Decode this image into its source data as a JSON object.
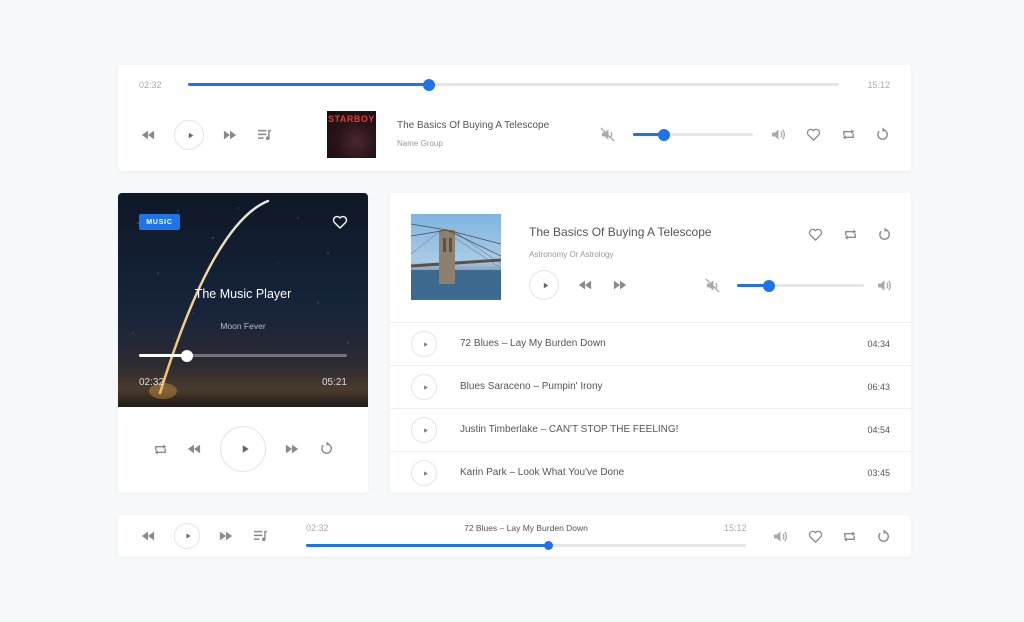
{
  "top_player": {
    "elapsed": "02:32",
    "duration": "15:12",
    "progress": 0.37,
    "track_title": "The Basics Of Buying A Telescope",
    "artist": "Name Group",
    "album_art_text": "STARBOY",
    "volume": 0.26
  },
  "card_player": {
    "badge": "MUSIC",
    "title": "The Music Player",
    "artist": "Moon Fever",
    "elapsed": "02:32",
    "duration": "05:21",
    "progress": 0.23
  },
  "playlist": {
    "title": "The Basics Of Buying A Telescope",
    "subtitle": "Astronomy Or Astrology",
    "volume": 0.25,
    "tracks": [
      {
        "title": "72 Blues – Lay My Burden Down",
        "time": "04:34"
      },
      {
        "title": "Blues Saraceno – Pumpin' Irony",
        "time": "06:43"
      },
      {
        "title": "Justin Timberlake – CAN'T STOP THE FEELING!",
        "time": "04:54"
      },
      {
        "title": "Karin Park – Look What You've Done",
        "time": "03:45"
      }
    ]
  },
  "bottom_player": {
    "elapsed": "02:32",
    "duration": "15:12",
    "track_title": "72 Blues – Lay My Burden Down",
    "progress": 0.55
  },
  "colors": {
    "accent": "#1f73e8",
    "background": "#f7f8fa"
  }
}
